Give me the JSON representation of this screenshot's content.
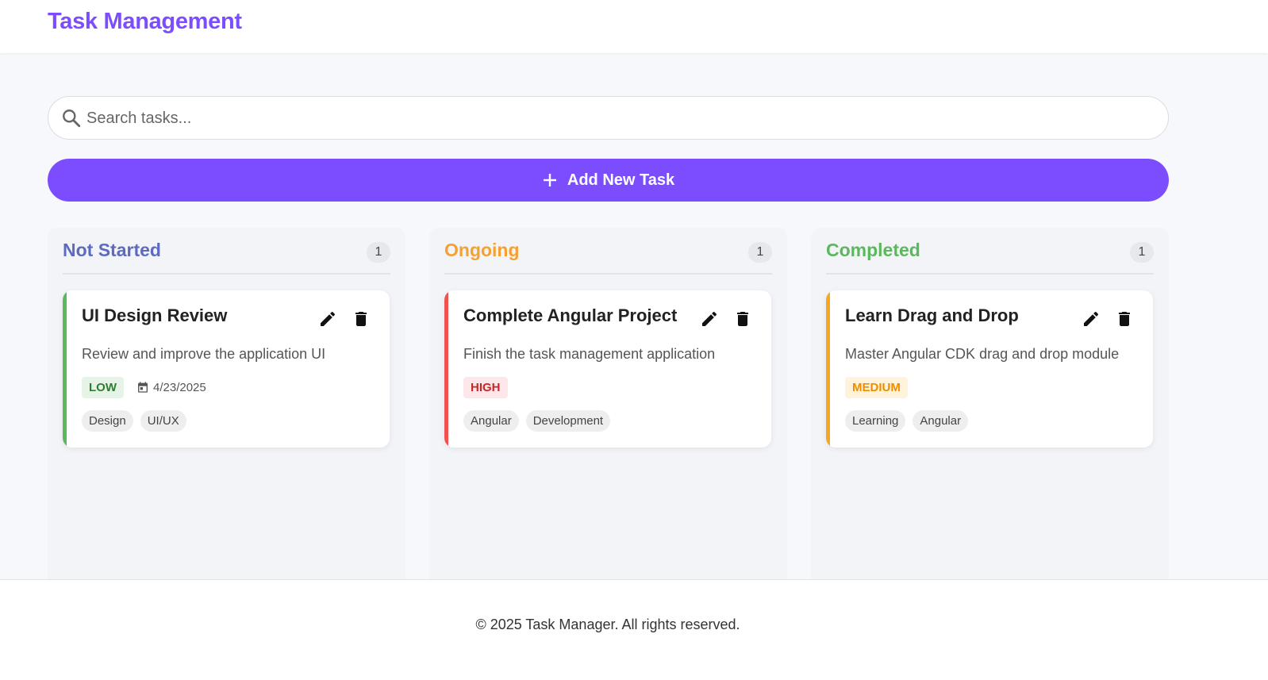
{
  "header": {
    "title": "Task Management",
    "accent_color": "#7c4dff"
  },
  "search": {
    "placeholder": "Search tasks...",
    "value": "",
    "icon": "search-icon"
  },
  "add_button": {
    "label": "Add New Task",
    "icon": "plus-icon",
    "color": "#7c4dff"
  },
  "columns": [
    {
      "title": "Not Started",
      "count": "1",
      "color": "#5c6bc0",
      "cards": [
        {
          "title": "UI Design Review",
          "description": "Review and improve the application UI",
          "priority": "LOW",
          "priority_color": "#2e7d32",
          "priority_bg": "#e6f4e7",
          "stripe_color": "#5cb85c",
          "due_date": "4/23/2025",
          "tags": [
            "Design",
            "UI/UX"
          ]
        }
      ]
    },
    {
      "title": "Ongoing",
      "count": "1",
      "color": "#f5a033",
      "cards": [
        {
          "title": "Complete Angular Project",
          "description": "Finish the task management application",
          "priority": "HIGH",
          "priority_color": "#c62828",
          "priority_bg": "#fde7ea",
          "stripe_color": "#ef5350",
          "tags": [
            "Angular",
            "Development"
          ]
        }
      ]
    },
    {
      "title": "Completed",
      "count": "1",
      "color": "#5cb85c",
      "cards": [
        {
          "title": "Learn Drag and Drop",
          "description": "Master Angular CDK drag and drop module",
          "priority": "MEDIUM",
          "priority_color": "#ef8c00",
          "priority_bg": "#fff3dc",
          "stripe_color": "#f5a623",
          "tags": [
            "Learning",
            "Angular"
          ]
        }
      ]
    }
  ],
  "footer": {
    "text": "© 2025 Task Manager. All rights reserved."
  }
}
